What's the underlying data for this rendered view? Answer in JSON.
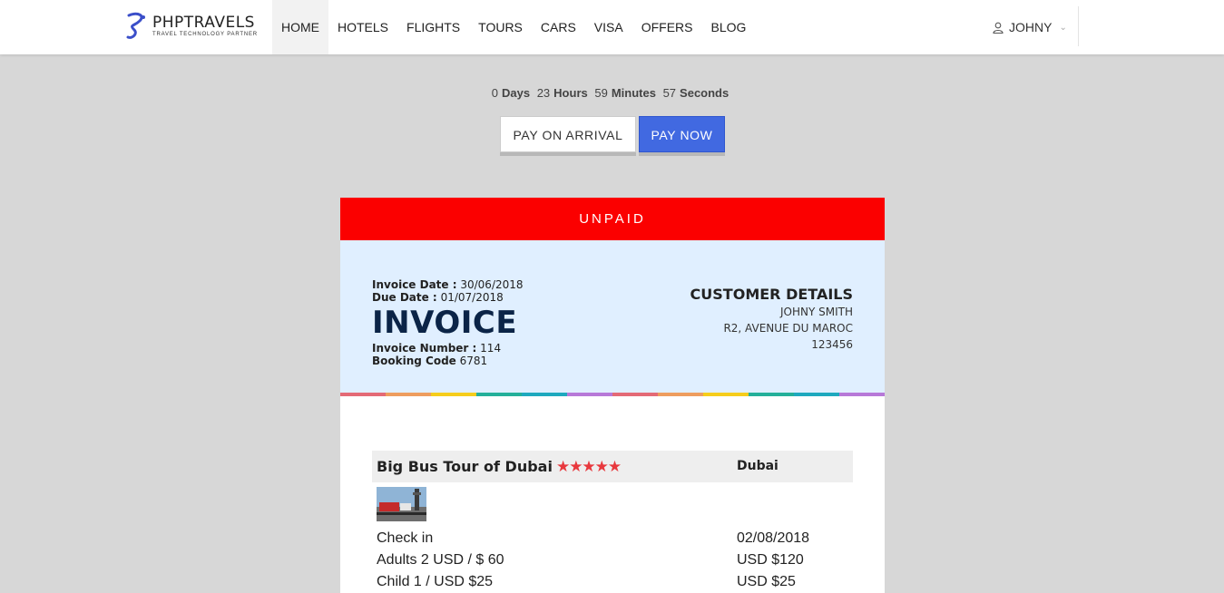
{
  "header": {
    "logo_text": "PHPTRAVELS",
    "logo_tagline": "TRAVEL TECHNOLOGY PARTNER",
    "nav": [
      {
        "label": "HOME",
        "active": true
      },
      {
        "label": "HOTELS"
      },
      {
        "label": "FLIGHTS"
      },
      {
        "label": "TOURS"
      },
      {
        "label": "CARS"
      },
      {
        "label": "VISA"
      },
      {
        "label": "OFFERS"
      },
      {
        "label": "BLOG"
      }
    ],
    "user_name": "JOHNY"
  },
  "countdown": {
    "days": "0",
    "days_label": "Days",
    "hours": "23",
    "hours_label": "Hours",
    "minutes": "59",
    "minutes_label": "Minutes",
    "seconds": "57",
    "seconds_label": "Seconds"
  },
  "actions": {
    "pay_on_arrival": "PAY ON ARRIVAL",
    "pay_now": "PAY NOW"
  },
  "invoice": {
    "status": "UNPAID",
    "invoice_date_label": "Invoice Date :",
    "invoice_date": "30/06/2018",
    "due_date_label": "Due Date :",
    "due_date": "01/07/2018",
    "title": "INVOICE",
    "invoice_number_label": "Invoice Number :",
    "invoice_number": "114",
    "booking_code_label": "Booking Code",
    "booking_code": "6781",
    "customer": {
      "heading": "CUSTOMER DETAILS",
      "name": "JOHNY SMITH",
      "address": "R2, AVENUE DU MAROC",
      "phone": "123456"
    },
    "stripe_colors": [
      "#e46a76",
      "#ee9d5f",
      "#f6cd1b",
      "#24b09a",
      "#1ea9be",
      "#b779d8",
      "#e46a76",
      "#ee9d5f",
      "#f6cd1b",
      "#24b09a",
      "#1ea9be",
      "#b779d8"
    ]
  },
  "tour": {
    "name": "Big Bus Tour of Dubai",
    "stars": "★★★★★",
    "rating": 5,
    "city": "Dubai",
    "rows": [
      {
        "label": "Check in",
        "value": "02/08/2018"
      },
      {
        "label": "Adults 2 USD / $ 60",
        "value": "USD $120"
      },
      {
        "label": "Child 1 / USD $25",
        "value": "USD $25"
      }
    ]
  }
}
